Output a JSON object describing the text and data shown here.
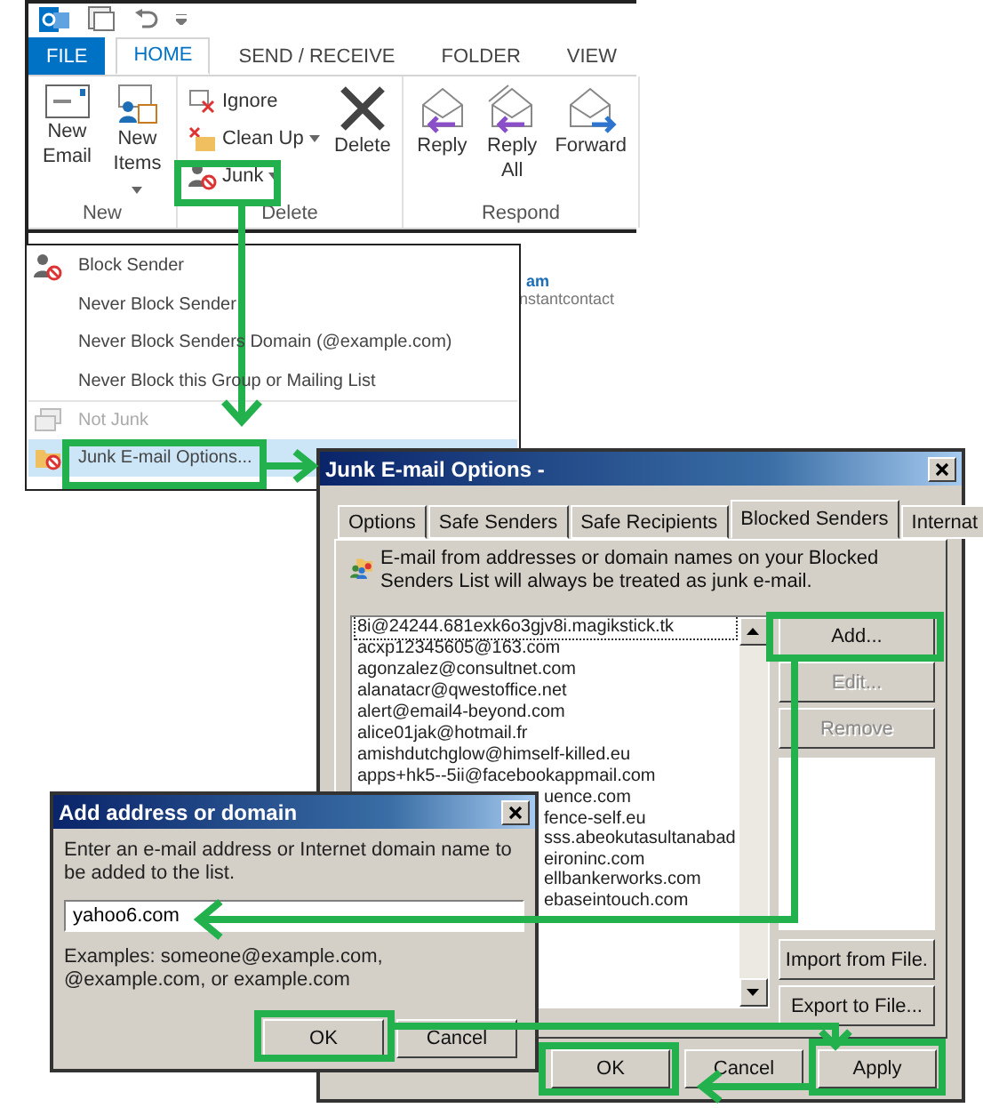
{
  "ribbon": {
    "tabs": [
      {
        "label": "FILE",
        "kind": "file",
        "selected": false
      },
      {
        "label": "HOME",
        "kind": "tab",
        "selected": true
      },
      {
        "label": "SEND / RECEIVE",
        "kind": "tab",
        "selected": false
      },
      {
        "label": "FOLDER",
        "kind": "tab",
        "selected": false
      },
      {
        "label": "VIEW",
        "kind": "tab",
        "selected": false
      }
    ],
    "new_group": {
      "label": "New",
      "new_email": "New Email",
      "new_items": "New Items"
    },
    "delete_group": {
      "label": "Delete",
      "ignore": "Ignore",
      "clean_up": "Clean Up",
      "junk": "Junk",
      "delete": "Delete"
    },
    "respond_group": {
      "label": "Respond",
      "reply": "Reply",
      "reply_all": "Reply All",
      "forward": "Forward"
    }
  },
  "mail_list": {
    "sender": "am",
    "preview": "nstantcontact"
  },
  "junk_menu": [
    {
      "label": "Block Sender",
      "disabled": false,
      "selected": false,
      "separator_before": false
    },
    {
      "label": "Never Block Sender",
      "disabled": false,
      "selected": false,
      "separator_before": false
    },
    {
      "label": "Never Block Senders Domain (@example.com)",
      "disabled": false,
      "selected": false,
      "separator_before": false
    },
    {
      "label": "Never Block this Group or Mailing List",
      "disabled": false,
      "selected": false,
      "separator_before": false
    },
    {
      "label": "Not Junk",
      "disabled": true,
      "selected": false,
      "separator_before": true
    },
    {
      "label": "Junk E-mail Options...",
      "disabled": false,
      "selected": true,
      "separator_before": false
    }
  ],
  "junk_dialog": {
    "title": "Junk E-mail Options -",
    "tabs": [
      {
        "label": "Options",
        "selected": false
      },
      {
        "label": "Safe Senders",
        "selected": false
      },
      {
        "label": "Safe Recipients",
        "selected": false
      },
      {
        "label": "Blocked Senders",
        "selected": true
      },
      {
        "label": "Internat",
        "selected": false
      }
    ],
    "description": "E-mail from addresses or domain names on your Blocked Senders List will always be treated as junk e-mail.",
    "blocked_senders": [
      {
        "text": "8i@24244.681exk6o3gjv8i.magikstick.tk",
        "selected": true,
        "covered": false
      },
      {
        "text": "acxp12345605@163.com",
        "selected": false,
        "covered": false
      },
      {
        "text": "agonzalez@consultnet.com",
        "selected": false,
        "covered": false
      },
      {
        "text": "alanatacr@qwestoffice.net",
        "selected": false,
        "covered": false
      },
      {
        "text": "alert@email4-beyond.com",
        "selected": false,
        "covered": false
      },
      {
        "text": "alice01jak@hotmail.fr",
        "selected": false,
        "covered": false
      },
      {
        "text": "amishdutchglow@himself-killed.eu",
        "selected": false,
        "covered": false
      },
      {
        "text": "apps+hk5--5ii@facebookappmail.com",
        "selected": false,
        "covered": false
      },
      {
        "text": "uence.com",
        "selected": false,
        "covered": true
      },
      {
        "text": "fence-self.eu",
        "selected": false,
        "covered": true
      },
      {
        "text": "sss.abeokutasultanabad",
        "selected": false,
        "covered": true
      },
      {
        "text": "eironinc.com",
        "selected": false,
        "covered": true
      },
      {
        "text": "ellbankerworks.com",
        "selected": false,
        "covered": true
      },
      {
        "text": "ebaseintouch.com",
        "selected": false,
        "covered": true
      }
    ],
    "side_buttons": [
      {
        "label": "Add...",
        "disabled": false
      },
      {
        "label": "Edit...",
        "disabled": true
      },
      {
        "label": "Remove",
        "disabled": true
      }
    ],
    "file_buttons": [
      {
        "label": "Import from File.",
        "disabled": false
      },
      {
        "label": "Export to File...",
        "disabled": false
      }
    ],
    "footer_buttons": [
      {
        "label": "OK",
        "disabled": false
      },
      {
        "label": "Cancel",
        "disabled": false
      },
      {
        "label": "Apply",
        "disabled": false
      }
    ]
  },
  "add_dialog": {
    "title": "Add address or domain",
    "prompt": "Enter an e-mail address or Internet domain name to be added to the list.",
    "value": "yahoo6.com",
    "examples": "Examples: someone@example.com, @example.com, or example.com",
    "buttons": [
      {
        "label": "OK"
      },
      {
        "label": "Cancel"
      }
    ]
  }
}
